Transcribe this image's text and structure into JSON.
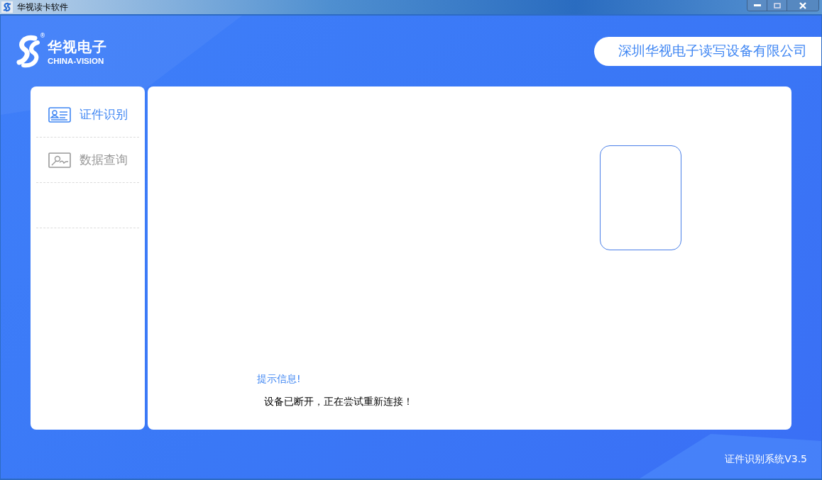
{
  "window": {
    "title": "华视读卡软件"
  },
  "logo": {
    "name": "华视电子",
    "subtitle": "CHINA-VISION",
    "mark": "®"
  },
  "company": "深圳华视电子读写设备有限公司",
  "sidebar": {
    "items": [
      {
        "label": "证件识别",
        "kind": "id-card",
        "selected": true
      },
      {
        "label": "数据查询",
        "kind": "photo",
        "selected": false
      }
    ]
  },
  "message": {
    "title": "提示信息!",
    "text": "设备已断开，正在尝试重新连接！"
  },
  "version": "证件识别系统V3.5"
}
